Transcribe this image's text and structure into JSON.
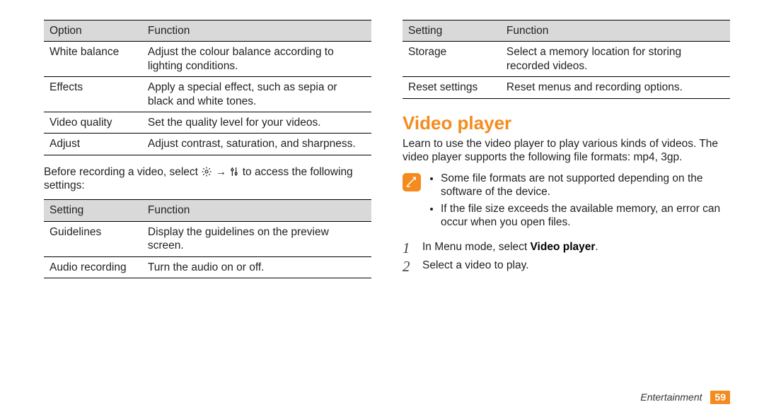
{
  "left": {
    "table1": {
      "head": [
        "Option",
        "Function"
      ],
      "rows": [
        [
          "White balance",
          "Adjust the colour balance according to lighting conditions."
        ],
        [
          "Effects",
          "Apply a special effect, such as sepia or black and white tones."
        ],
        [
          "Video quality",
          "Set the quality level for your videos."
        ],
        [
          "Adjust",
          "Adjust contrast, saturation, and sharpness."
        ]
      ]
    },
    "para_before": "Before recording a video, select ",
    "para_arrow": " → ",
    "para_after": " to access the following settings:",
    "table2": {
      "head": [
        "Setting",
        "Function"
      ],
      "rows": [
        [
          "Guidelines",
          "Display the guidelines on the preview screen."
        ],
        [
          "Audio recording",
          "Turn the audio on or off."
        ]
      ]
    }
  },
  "right": {
    "table3": {
      "head": [
        "Setting",
        "Function"
      ],
      "rows": [
        [
          "Storage",
          "Select a memory location for storing recorded videos."
        ],
        [
          "Reset settings",
          "Reset menus and recording options."
        ]
      ]
    },
    "title": "Video player",
    "intro": "Learn to use the video player to play various kinds of videos. The video player supports the following file formats: mp4, 3gp.",
    "notes": [
      "Some file formats are not supported depending on the software of the device.",
      "If the file size exceeds the available memory, an error can occur when you open files."
    ],
    "steps": {
      "s1_pre": "In Menu mode, select ",
      "s1_bold": "Video player",
      "s1_post": ".",
      "s2": "Select a video to play."
    }
  },
  "footer": {
    "section": "Entertainment",
    "page": "59"
  }
}
